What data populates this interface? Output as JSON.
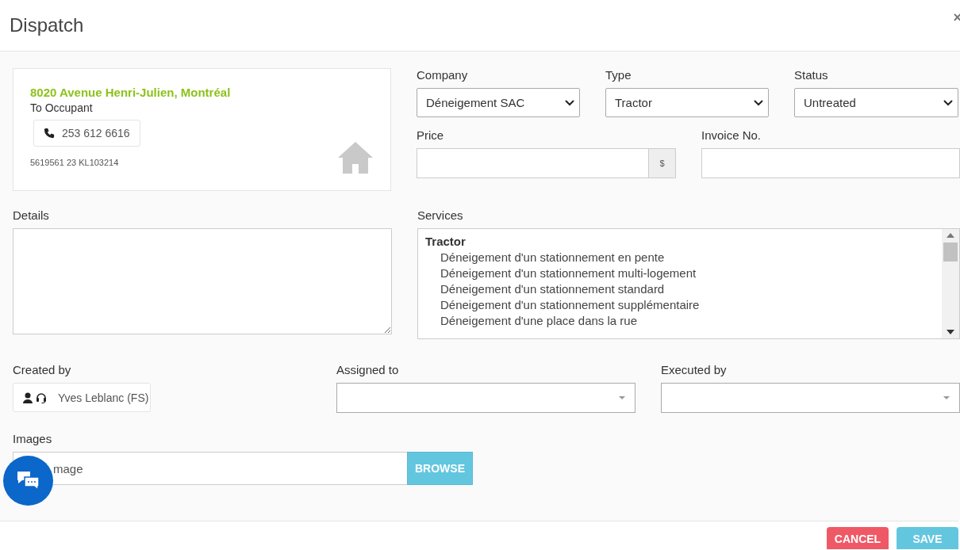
{
  "modal": {
    "title": "Dispatch",
    "close": "×"
  },
  "address_card": {
    "address": "8020 Avenue Henri-Julien, Montréal",
    "recipient": "To Occupant",
    "phone": "253 612 6616",
    "reference": "5619561 23 KL103214"
  },
  "company": {
    "label": "Company",
    "value": "Déneigement SAC"
  },
  "type": {
    "label": "Type",
    "value": "Tractor"
  },
  "status": {
    "label": "Status",
    "value": "Untreated"
  },
  "price": {
    "label": "Price",
    "addon": "$"
  },
  "invoice": {
    "label": "Invoice No."
  },
  "details": {
    "label": "Details"
  },
  "services": {
    "label": "Services",
    "groups": [
      {
        "name": "Tractor",
        "items": [
          "Déneigement d'un stationnement en pente",
          "Déneigement d'un stationnement multi-logement",
          "Déneigement d'un stationnement standard",
          "Déneigement d'un stationnement supplémentaire",
          "Déneigement d'une place dans la rue"
        ]
      }
    ]
  },
  "created_by": {
    "label": "Created by",
    "value": "Yves Leblanc (FS)"
  },
  "assigned_to": {
    "label": "Assigned to"
  },
  "executed_by": {
    "label": "Executed by"
  },
  "images": {
    "label": "Images",
    "placeholder": "mage",
    "button": "BROWSE"
  },
  "footer": {
    "buttons": [
      {
        "label": "CANCEL",
        "kind": "danger"
      },
      {
        "label": "SAVE",
        "kind": "info"
      }
    ]
  }
}
